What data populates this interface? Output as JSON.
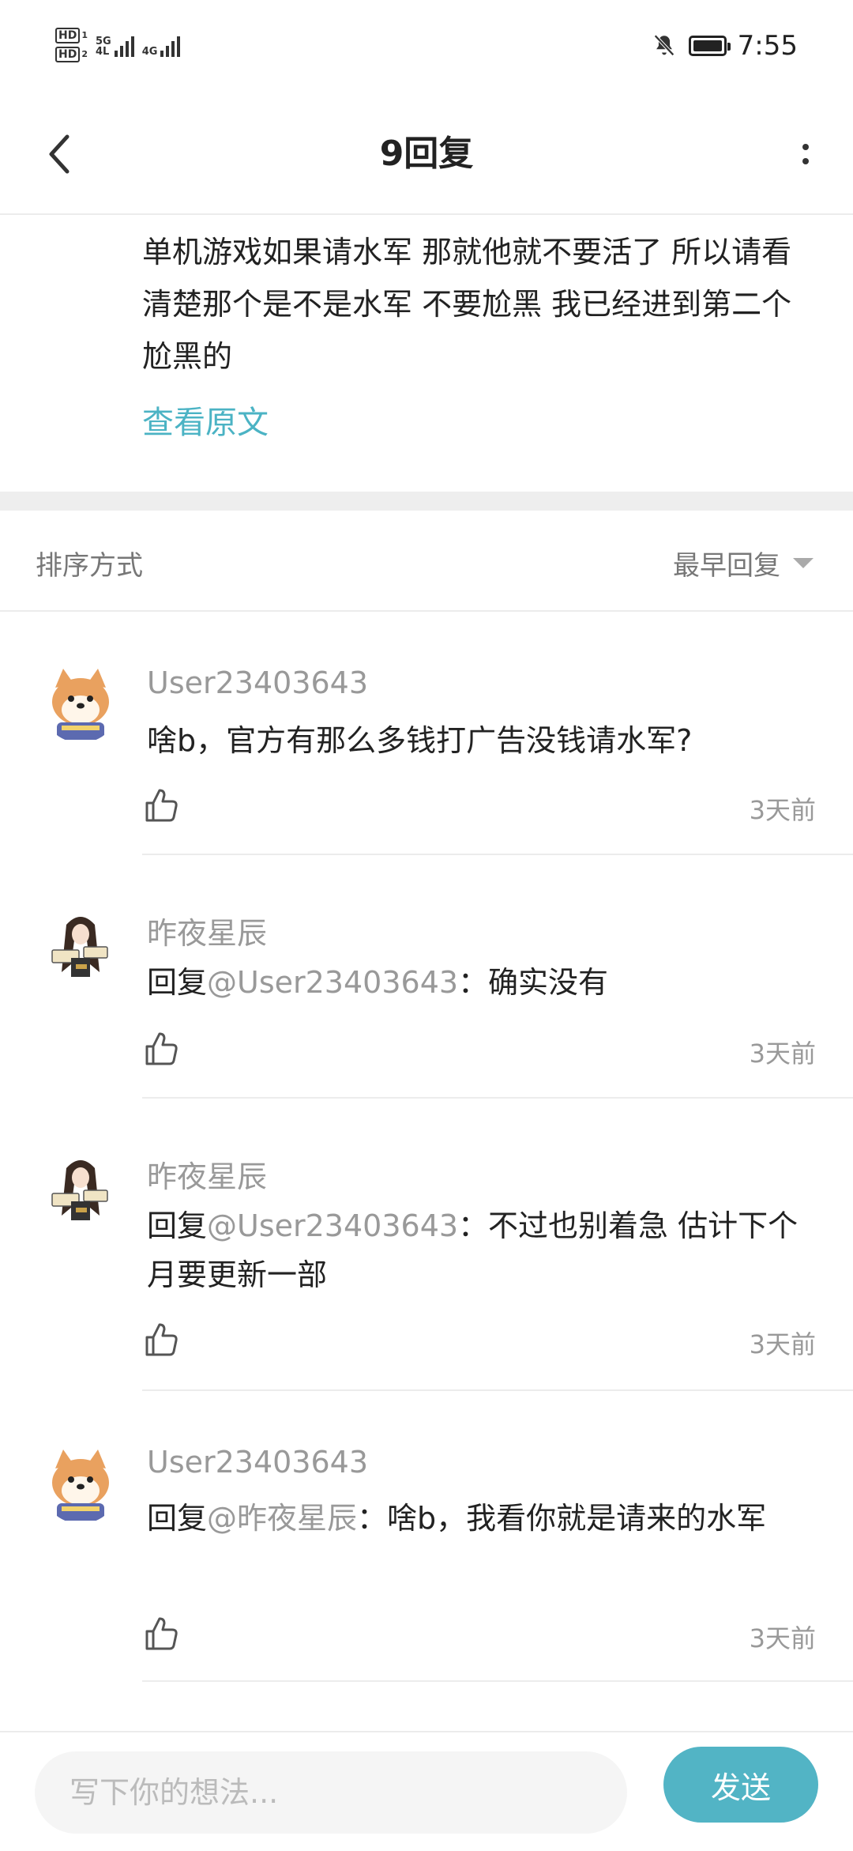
{
  "status_bar": {
    "hd1": "HD",
    "hd1_sub": "1",
    "hd2": "HD",
    "hd2_sub": "2",
    "net1_top": "5G",
    "net1_bottom": "4L",
    "net2": "4G",
    "time": "7:55"
  },
  "header": {
    "title": "9回复"
  },
  "original_post": {
    "text": "单机游戏如果请水军 那就他就不要活了 所以请看清楚那个是不是水军 不要尬黑 我已经进到第二个尬黑的",
    "view_original_label": "查看原文"
  },
  "sort": {
    "label": "排序方式",
    "selected": "最早回复"
  },
  "replies": [
    {
      "username": "User23403643",
      "prefix": "",
      "mention": "",
      "content": "啥b，官方有那么多钱打广告没钱请水军?",
      "time": "3天前",
      "avatar": "shiba-avatar"
    },
    {
      "username": "昨夜星辰",
      "prefix": "回复",
      "mention": "@User23403643",
      "content": "：确实没有",
      "time": "3天前",
      "avatar": "anime-girl-avatar"
    },
    {
      "username": "昨夜星辰",
      "prefix": "回复",
      "mention": "@User23403643",
      "content": "：不过也别着急 估计下个月要更新一部",
      "time": "3天前",
      "avatar": "anime-girl-avatar"
    },
    {
      "username": "User23403643",
      "prefix": "回复",
      "mention": "@昨夜星辰",
      "content": "：啥b，我看你就是请来的水军",
      "time": "3天前",
      "avatar": "shiba-avatar"
    }
  ],
  "composer": {
    "placeholder": "写下你的想法...",
    "send_label": "发送"
  },
  "colors": {
    "accent": "#52b4c5",
    "link": "#4bb3c4",
    "muted": "#999999"
  }
}
